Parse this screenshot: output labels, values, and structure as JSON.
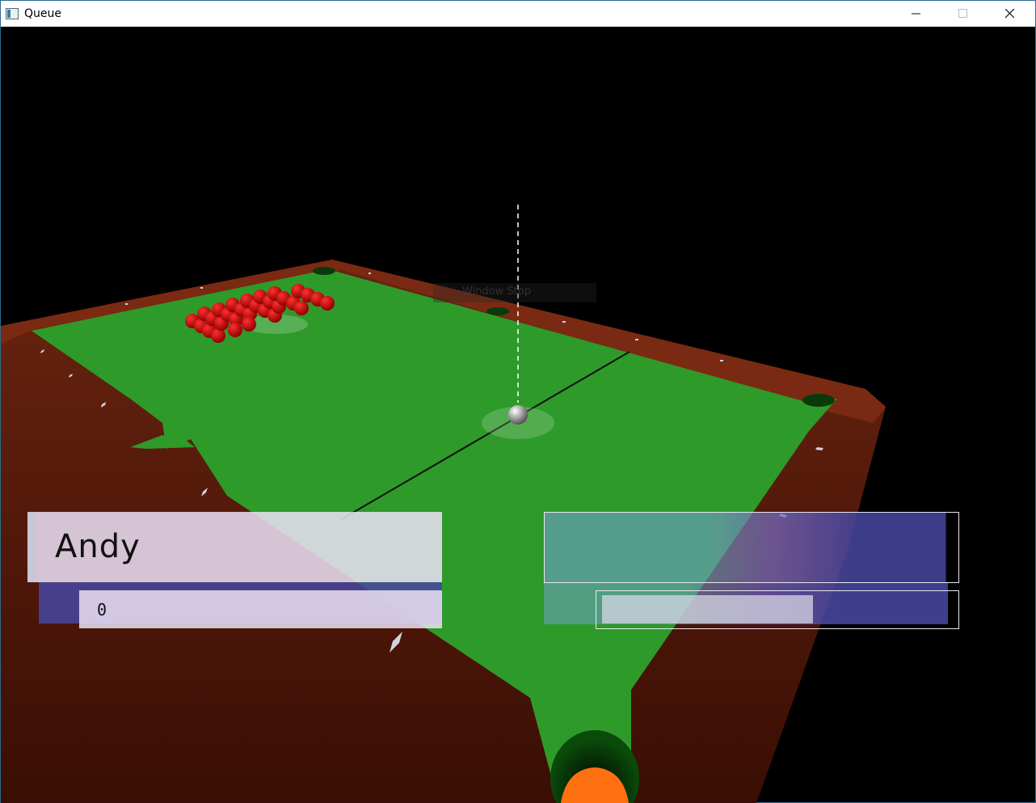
{
  "window": {
    "title": "Queue",
    "icon": "app-window-icon",
    "controls": {
      "minimize": "minimize-icon",
      "maximize": "maximize-icon",
      "close": "close-icon"
    }
  },
  "game": {
    "ghost_menu_label": "Window Stop",
    "player": {
      "name": "Andy",
      "score": "0"
    },
    "opponent": {
      "name": "",
      "score": ""
    },
    "colors": {
      "cloth": "#2e9a2a",
      "rail": "#5a1a08",
      "balls": "#e00000",
      "cue_ball": "#ffffff",
      "pocket_marker": "#ff7010",
      "panel_blue": "#46469e"
    }
  }
}
